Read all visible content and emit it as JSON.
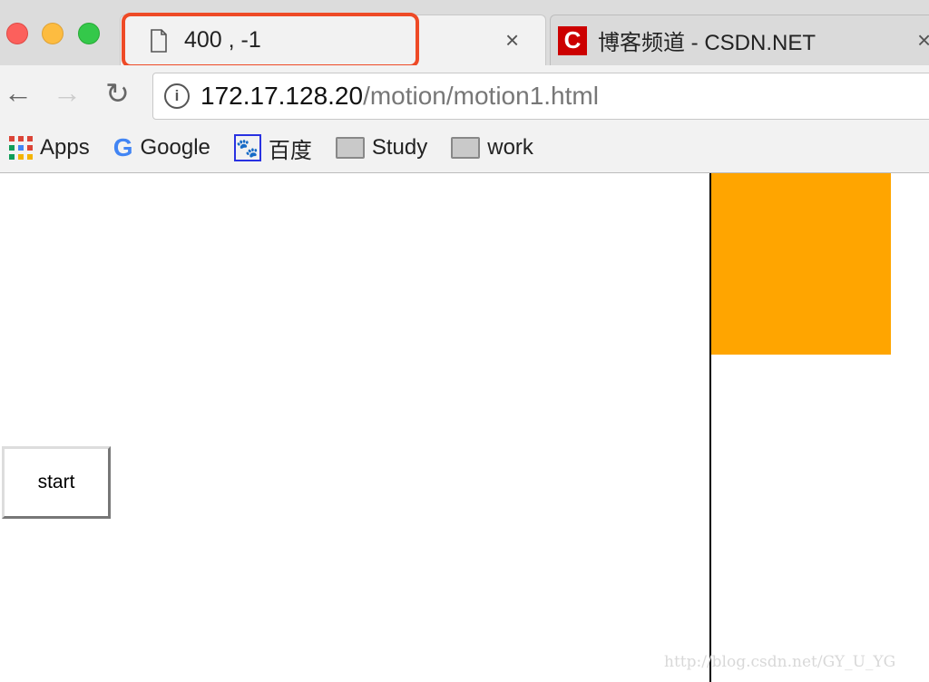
{
  "browser": {
    "tabs": [
      {
        "title": "400 , -1",
        "icon": "file-icon",
        "active": true
      },
      {
        "title": "博客频道 - CSDN.NET",
        "icon": "csdn-logo-icon",
        "active": false
      }
    ],
    "address": {
      "host": "172.17.128.20",
      "path": "/motion/motion1.html"
    },
    "bookmarks": [
      {
        "label": "Apps",
        "icon": "apps-grid-icon"
      },
      {
        "label": "Google",
        "icon": "google-icon"
      },
      {
        "label": "百度",
        "icon": "baidu-paw-icon"
      },
      {
        "label": "Study",
        "icon": "folder-icon"
      },
      {
        "label": "work",
        "icon": "folder-icon"
      }
    ],
    "highlight_color": "#ee4a26"
  },
  "page": {
    "button_label": "start",
    "box_color": "#ffa500",
    "watermark": "http://blog.csdn.net/GY_U_YG"
  }
}
